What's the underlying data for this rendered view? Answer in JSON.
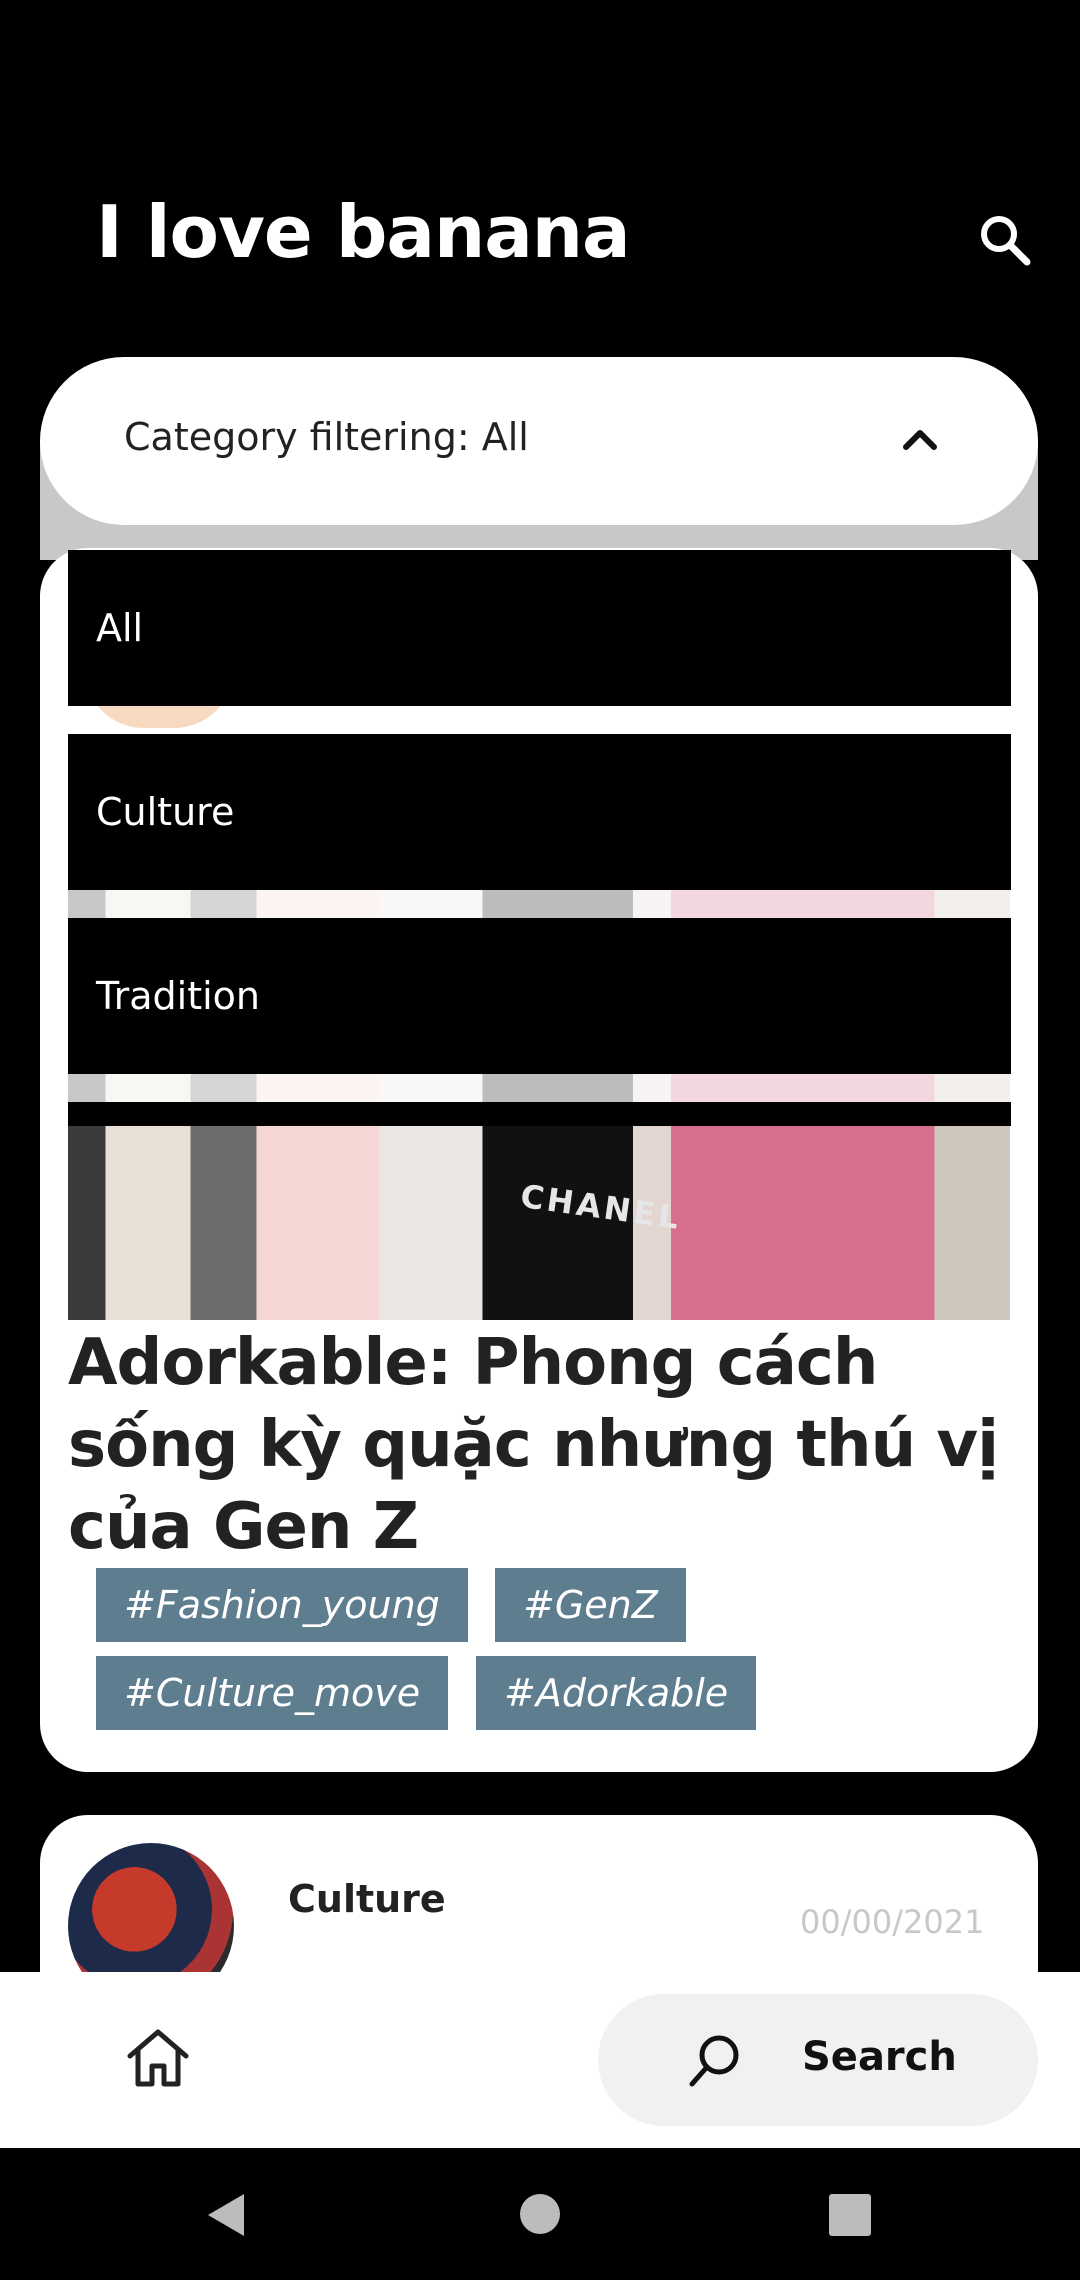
{
  "header": {
    "title": "I love banana",
    "search_icon": "search-icon"
  },
  "filter": {
    "label": "Category filtering: All",
    "chevron_icon": "chevron-up-icon"
  },
  "dropdown": {
    "options": [
      "All",
      "Culture",
      "Tradition"
    ]
  },
  "article": {
    "image_text": "CHANEL",
    "title": "Adorkable: Phong cách sống kỳ quặc nhưng thú vị của Gen Z",
    "tags": [
      "#Fashion_young",
      "#GenZ",
      "#Culture_move",
      "#Adorkable"
    ]
  },
  "next_card": {
    "category": "Culture",
    "date": "00/00/2021"
  },
  "bottom_nav": {
    "home_icon": "home-icon",
    "search_label": "Search"
  },
  "colors": {
    "background": "#000000",
    "tag": "#5e7d8e",
    "card": "#ffffff"
  }
}
